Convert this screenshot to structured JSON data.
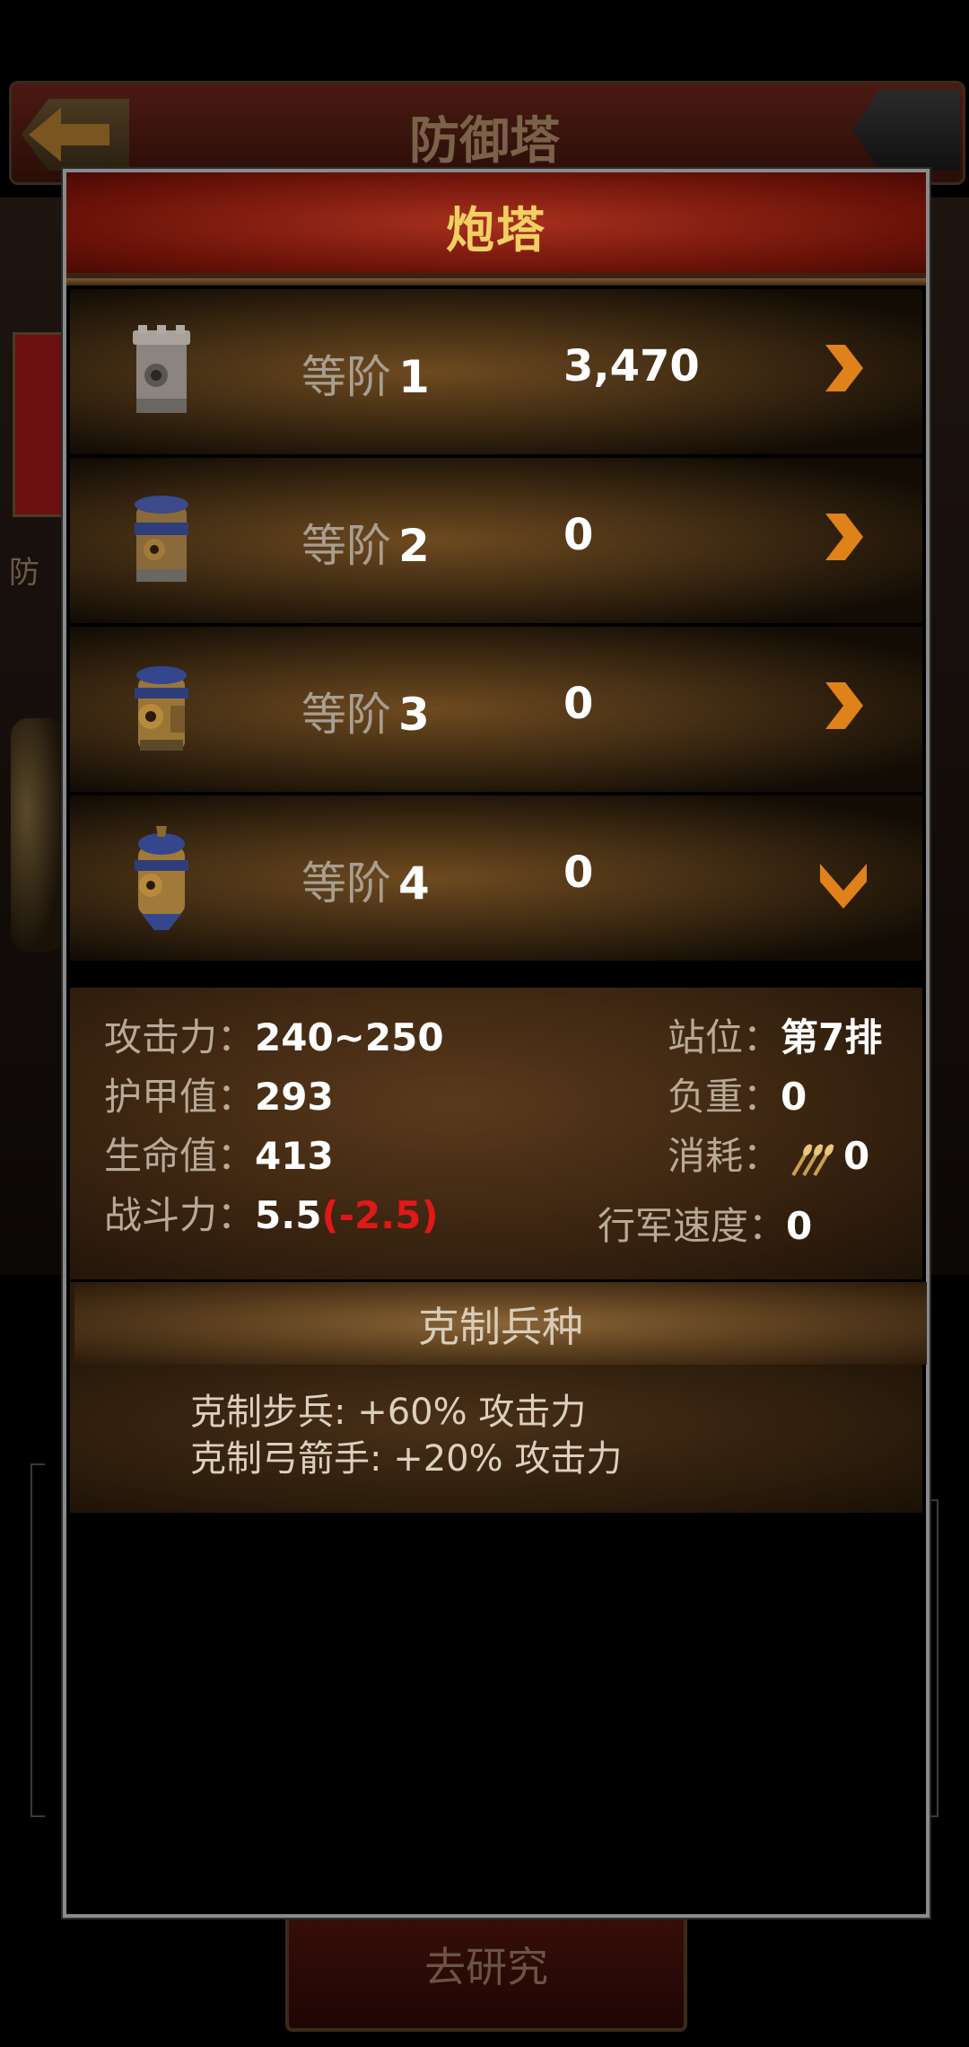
{
  "background": {
    "screen_title": "防御塔",
    "side_label": "防",
    "research_button_label": "去研究"
  },
  "dialog": {
    "title": "炮塔",
    "tiers": [
      {
        "label": "等阶",
        "level": "1",
        "count": "3,470",
        "arrow": "chevron-right-icon"
      },
      {
        "label": "等阶",
        "level": "2",
        "count": "0",
        "arrow": "chevron-right-icon"
      },
      {
        "label": "等阶",
        "level": "3",
        "count": "0",
        "arrow": "chevron-right-icon"
      },
      {
        "label": "等阶",
        "level": "4",
        "count": "0",
        "arrow": "chevron-down-icon"
      }
    ],
    "stats": {
      "attack": {
        "label": "攻击力：",
        "value": "240~250"
      },
      "armor": {
        "label": "护甲值：",
        "value": "293"
      },
      "hp": {
        "label": "生命值：",
        "value": "413"
      },
      "power": {
        "label": "战斗力：",
        "value": "5.5",
        "delta": "(-2.5)"
      },
      "position": {
        "label": "站位：",
        "value": "第7排"
      },
      "load": {
        "label": "负重：",
        "value": "0"
      },
      "consumption": {
        "label": "消耗：",
        "value": "0",
        "icon": "wheat-icon"
      },
      "march_speed": {
        "label": "行军速度：",
        "value": "0"
      }
    },
    "counter": {
      "title": "克制兵种",
      "lines": [
        "克制步兵: +60% 攻击力",
        "克制弓箭手: +20% 攻击力"
      ]
    }
  },
  "colors": {
    "title_gold": "#f2cf63",
    "arrow_orange": "#e0821a",
    "negative_red": "#e01818",
    "header_red": "#a8301e"
  }
}
